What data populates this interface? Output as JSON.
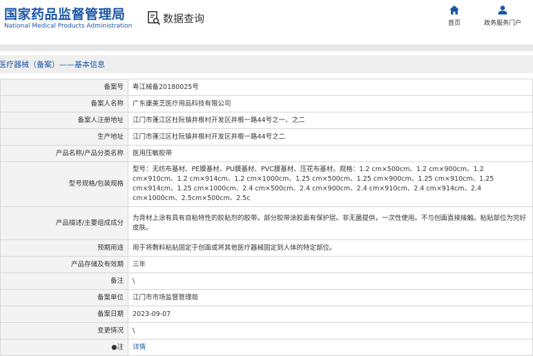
{
  "header": {
    "logo_cn": "国家药品监督管理局",
    "logo_en": "National Medical Products Administration",
    "search_title": "数据查询",
    "nav": [
      {
        "label": "首页",
        "icon": "home-icon"
      },
      {
        "label": "政务服务门户",
        "icon": "user-icon"
      }
    ]
  },
  "section": {
    "title": "医疗器械（备案）——基本信息"
  },
  "rows": [
    {
      "label": "备案号",
      "value": "粤江械备20180025号"
    },
    {
      "label": "备案人名称",
      "value": "广东康美芝医疗用品科技有限公司"
    },
    {
      "label": "备案人注册地址",
      "value": "江门市蓬江区杜阮镇井根村开发区井根一路44号之一、之二"
    },
    {
      "label": "生产地址",
      "value": "江门市蓬江区杜阮镇井根村开发区井根一路44号之二"
    },
    {
      "label": "产品名称/产品分类名称",
      "value": "医用压敏胶带"
    },
    {
      "label": "型号规格/包装规格",
      "value": "型号：无纺布基材、PE膜基材、PU膜基材、PVC膜基材、压花布基材。规格：1.2 cm×500cm、1.2 cm×900cm、1.2 cm×910cm、1.2 cm×914cm、1.2 cm×1000cm、1.25 cm×500cm、1.25 cm×900cm、1.25 cm×910cm、1.25 cm×914cm、1.25 cm×1000cm、2.4 cm×500cm、2.4 cm×900cm、2.4 cm×910cm、2.4 cm×914cm、2.4 cm×1000cm、2.5cm×500cm、2.5c"
    },
    {
      "label": "产品描述/主要组成成分",
      "value": "为背材上涂有具有自粘特性的胶粘剂的胶带。部分胶带涂胶面有保护层。非无菌提供，一次性使用。不与创面直接接触。粘贴部位为完好皮肤。"
    },
    {
      "label": "预期用途",
      "value": "用于将敷料粘贴固定于创面或将其他医疗器械固定到人体的特定部位。"
    },
    {
      "label": "产品存储及有效期",
      "value": "三年"
    },
    {
      "label": "备注",
      "value": "\\"
    },
    {
      "label": "备案单位",
      "value": "江门市市场监督管理局"
    },
    {
      "label": "备案日期",
      "value": "2023-09-07"
    },
    {
      "label": "变更情况",
      "value": "\\"
    },
    {
      "label": "●注",
      "value": "详情",
      "link": true
    }
  ]
}
